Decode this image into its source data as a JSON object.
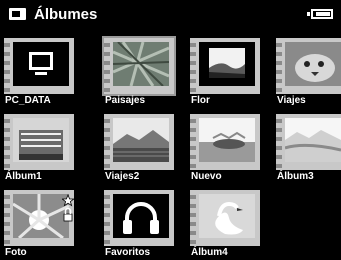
{
  "header": {
    "title": "Álbumes",
    "app_icon": "album-icon",
    "battery_icon": "battery-icon"
  },
  "albums": [
    {
      "label": "PC_DATA",
      "icon": "computer-icon"
    },
    {
      "label": "Paisajes",
      "icon": "nature-photo",
      "selected": true
    },
    {
      "label": "Flor",
      "icon": "landscape-photo"
    },
    {
      "label": "Viajes",
      "icon": "animal-photo"
    },
    {
      "label": "Álbum1",
      "icon": "building-photo"
    },
    {
      "label": "Viajes2",
      "icon": "mountain-photo"
    },
    {
      "label": "Nuevo",
      "icon": "lake-photo"
    },
    {
      "label": "Álbum3",
      "icon": "snow-photo"
    },
    {
      "label": "Foto",
      "icon": "sunburst-photo",
      "badges": [
        "star-icon",
        "lock-icon"
      ]
    },
    {
      "label": "Favoritos",
      "icon": "headphones-icon"
    },
    {
      "label": "Álbum4",
      "icon": "swan-photo"
    }
  ],
  "colors": {
    "background": "#000000",
    "frame": "#c8c8c8",
    "text": "#ffffff"
  }
}
